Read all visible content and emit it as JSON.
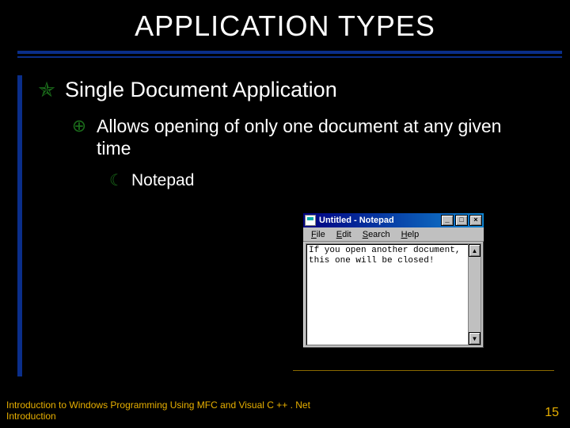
{
  "title": "APPLICATION TYPES",
  "bullets": {
    "l1": {
      "icon": "✯",
      "text": "Single Document Application"
    },
    "l2": {
      "icon": "⊕",
      "text": "Allows opening of only one document at any given time"
    },
    "l3": {
      "icon": "☾",
      "text": "Notepad"
    }
  },
  "notepad": {
    "title": "Untitled - Notepad",
    "menu": {
      "file": "File",
      "edit": "Edit",
      "search": "Search",
      "help": "Help"
    },
    "buttons": {
      "min": "_",
      "max": "□",
      "close": "×"
    },
    "scroll": {
      "up": "▲",
      "down": "▼"
    },
    "body": "If you open another document,\nthis one will be closed!"
  },
  "footer": {
    "line1": "Introduction to Windows Programming Using MFC and Visual C ++ . Net",
    "line2": "Introduction"
  },
  "page_number": "15"
}
